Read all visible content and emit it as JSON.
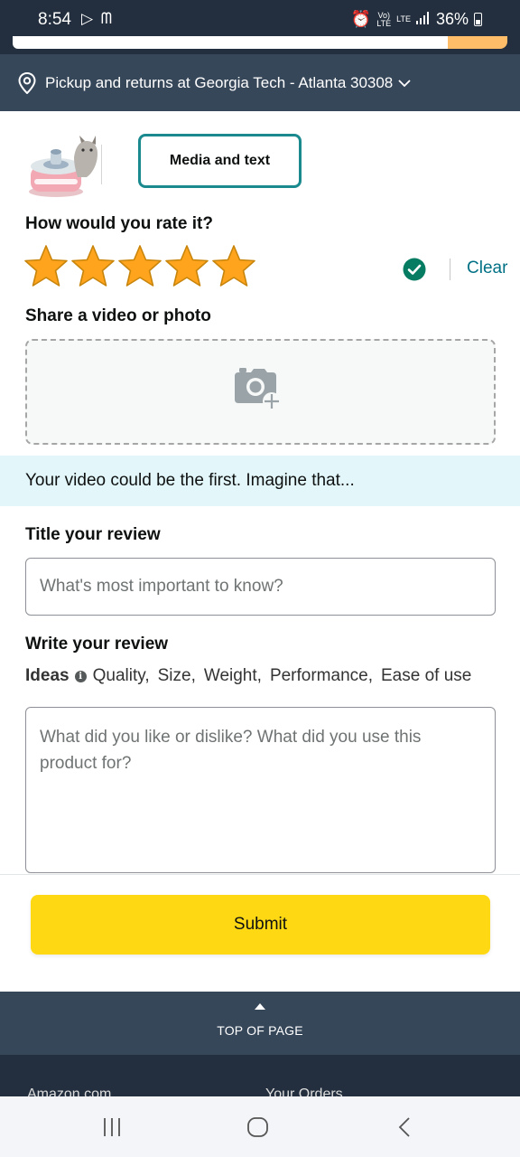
{
  "status_bar": {
    "time": "8:54",
    "left_icons": "▷ ᗰ",
    "network_top": "Vo)",
    "network_bottom": "LTE",
    "lte_label": "LTE",
    "battery_percent": "36%"
  },
  "location": {
    "text": "Pickup and returns at Georgia Tech - Atlanta 30308"
  },
  "review_form": {
    "media_button_label": "Media and text",
    "rating_heading": "How would you rate it?",
    "rating": 5,
    "rating_max": 5,
    "clear_label": "Clear",
    "media_heading": "Share a video or photo",
    "info_banner": "Your video could be the first. Imagine that...",
    "title_heading": "Title your review",
    "title_placeholder": "What's most important to know?",
    "review_heading": "Write your review",
    "ideas_label": "Ideas",
    "ideas": [
      "Quality,",
      "Size,",
      "Weight,",
      "Performance,",
      "Ease of use"
    ],
    "review_placeholder": "What did you like or dislike? What did you use this product for?",
    "submit_label": "Submit"
  },
  "footer": {
    "top_of_page": "TOP OF PAGE",
    "links": [
      "Amazon.com",
      "Your Orders"
    ]
  },
  "colors": {
    "header_dark": "#232f3e",
    "location_bar": "#37475a",
    "star": "#ffa41c",
    "link": "#007185",
    "accent_teal": "#1b8a8f",
    "submit": "#ffd814",
    "banner": "#e3f7fa"
  }
}
